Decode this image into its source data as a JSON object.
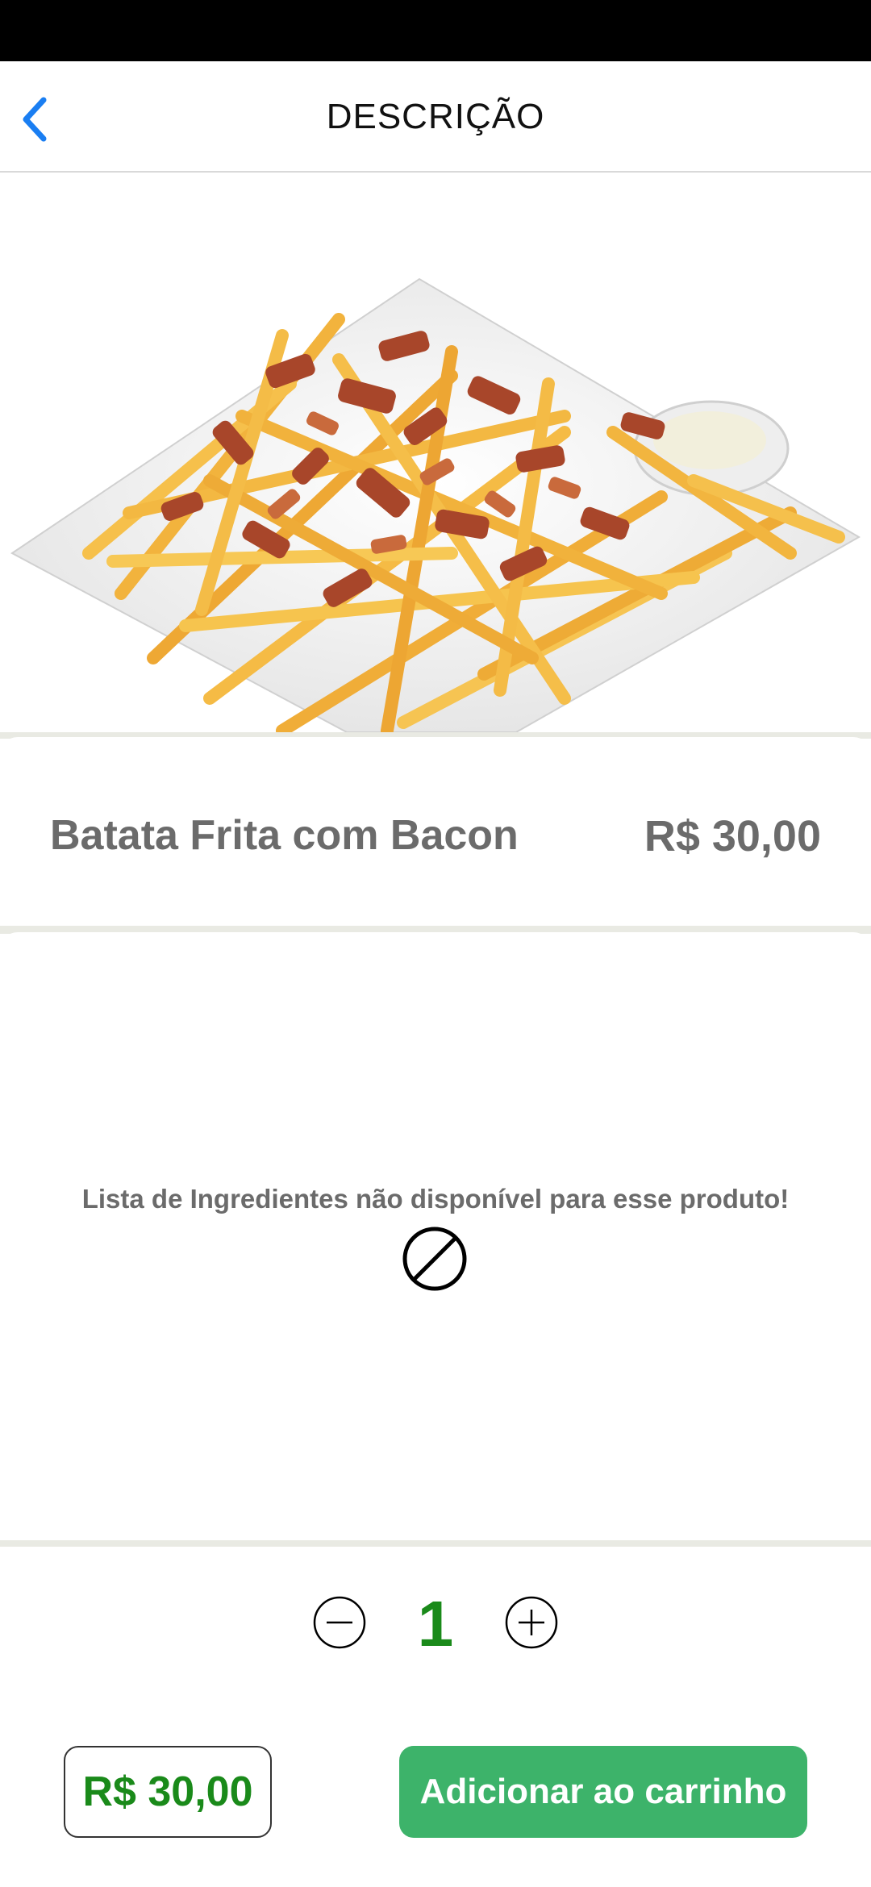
{
  "header": {
    "title": "DESCRIÇÃO",
    "back_icon": "chevron-left-icon",
    "accent_color": "#1a7ef2"
  },
  "product": {
    "image_description": "food-photo",
    "name": "Batata Frita com Bacon",
    "price": "R$ 30,00"
  },
  "ingredients": {
    "message": "Lista de Ingredientes não disponível para esse produto!",
    "icon": "no-entry-icon"
  },
  "quantity": {
    "value": "1",
    "decrement_icon": "minus-circle-icon",
    "increment_icon": "plus-circle-icon",
    "value_color": "#1a8a1a"
  },
  "footer": {
    "total": "R$ 30,00",
    "add_button_label": "Adicionar ao carrinho",
    "button_color": "#3db36a"
  }
}
